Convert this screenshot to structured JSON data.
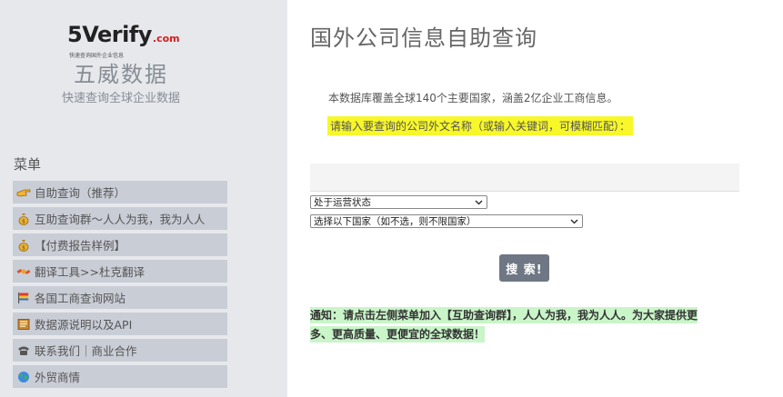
{
  "sidebar": {
    "logo": {
      "five": "5",
      "verify": "Verify",
      "dotcom": ".com",
      "tagline": "快速查询国外企业信息"
    },
    "brand_name": "五威数据",
    "brand_subtitle": "快速查询全球企业数据",
    "menu_title": "菜单",
    "items": [
      {
        "label": "自助查询（推荐）",
        "icon": "pointing-hand-icon"
      },
      {
        "label": "互助查询群～人人为我，我为人人",
        "icon": "money-bag-icon"
      },
      {
        "label": "【付费报告样例】",
        "icon": "money-bag-icon"
      },
      {
        "label": "翻译工具>>杜克翻译",
        "icon": "satellite-icon"
      },
      {
        "label": "各国工商查询网站",
        "icon": "flag-icon"
      },
      {
        "label": "数据源说明以及API",
        "icon": "book-icon"
      },
      {
        "label": "联系我们｜商业合作",
        "icon": "telephone-icon"
      },
      {
        "label": "外贸商情",
        "icon": "globe-icon"
      }
    ]
  },
  "main": {
    "title": "国外公司信息自助查询",
    "intro": "本数据库覆盖全球140个主要国家，涵盖2亿企业工商信息。",
    "hint": "请输入要查询的公司外文名称（或输入关键词，可模糊匹配）：",
    "search_input": {
      "value": "",
      "placeholder": ""
    },
    "status_select": {
      "selected": "处于运营状态"
    },
    "country_select": {
      "selected": "选择以下国家（如不选，则不限国家）"
    },
    "search_button_label": "搜 索!",
    "notice_line1": "通知：请点击左侧菜单加入【互助查询群】，人人为我，我为人人。为大家提供更",
    "notice_line2": "多、更高质量、更便宜的全球数据！"
  },
  "colors": {
    "sidebar_bg": "#e6e8ec",
    "menu_item_bg": "#c9cdd6",
    "hint_highlight": "#f7f72a",
    "notice_highlight": "#c9f5c9",
    "button_bg": "#6e7783",
    "logo_dotcom": "#d32020"
  }
}
